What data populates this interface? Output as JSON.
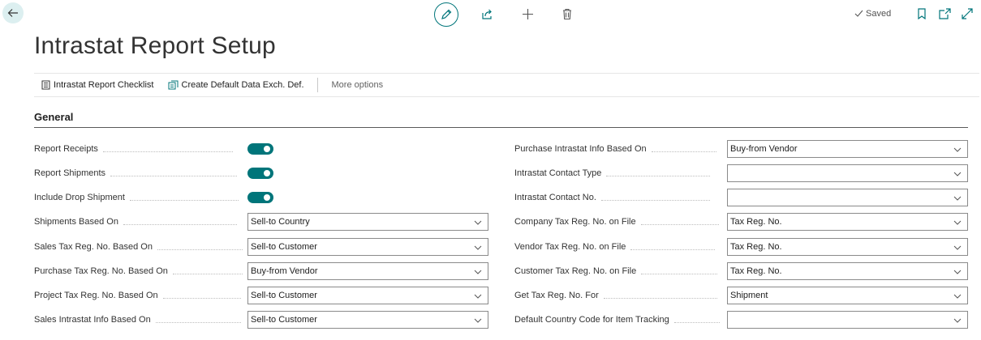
{
  "top": {
    "saved_text": "Saved"
  },
  "title": "Intrastat Report Setup",
  "actions": {
    "checklist": "Intrastat Report Checklist",
    "create_default": "Create Default Data Exch. Def.",
    "more": "More options"
  },
  "section": "General",
  "left": {
    "report_receipts": {
      "label": "Report Receipts",
      "on": true
    },
    "report_shipments": {
      "label": "Report Shipments",
      "on": true
    },
    "include_drop": {
      "label": "Include Drop Shipment",
      "on": true
    },
    "shipments_based_on": {
      "label": "Shipments Based On",
      "value": "Sell-to Country"
    },
    "sales_tax_reg": {
      "label": "Sales Tax Reg. No. Based On",
      "value": "Sell-to Customer"
    },
    "purchase_tax_reg": {
      "label": "Purchase Tax Reg. No. Based On",
      "value": "Buy-from Vendor"
    },
    "project_tax_reg": {
      "label": "Project Tax Reg. No. Based On",
      "value": "Sell-to Customer"
    },
    "sales_intrastat": {
      "label": "Sales Intrastat Info Based On",
      "value": "Sell-to Customer"
    }
  },
  "right": {
    "purchase_intrastat": {
      "label": "Purchase Intrastat Info Based On",
      "value": "Buy-from Vendor"
    },
    "contact_type": {
      "label": "Intrastat Contact Type",
      "value": ""
    },
    "contact_no": {
      "label": "Intrastat Contact No.",
      "value": ""
    },
    "company_tax": {
      "label": "Company Tax Reg. No. on File",
      "value": "Tax Reg. No."
    },
    "vendor_tax": {
      "label": "Vendor Tax Reg. No. on File",
      "value": "Tax Reg. No."
    },
    "customer_tax": {
      "label": "Customer Tax Reg. No. on File",
      "value": "Tax Reg. No."
    },
    "get_tax_for": {
      "label": "Get Tax Reg. No. For",
      "value": "Shipment"
    },
    "default_country": {
      "label": "Default Country Code for Item Tracking",
      "value": ""
    }
  }
}
